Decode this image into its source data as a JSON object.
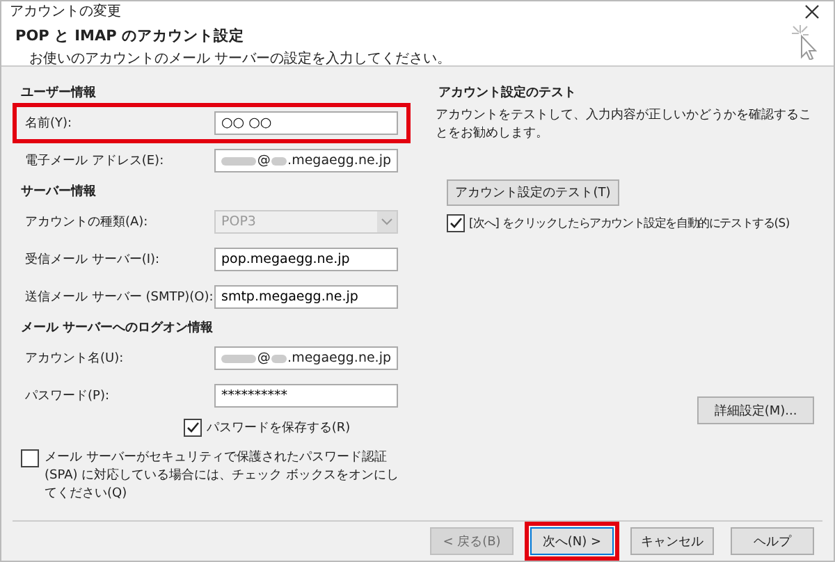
{
  "window": {
    "title": "アカウントの変更"
  },
  "header": {
    "title": "POP と IMAP のアカウント設定",
    "subtitle": "お使いのアカウントのメール サーバーの設定を入力してください。"
  },
  "left": [
    {
      "kind": "heading",
      "text": "ユーザー情報"
    },
    {
      "kind": "field",
      "label": "名前(Y):",
      "value": "○○ ○○",
      "highlighted": true
    },
    {
      "kind": "redacted",
      "label": "電子メール アドレス(E):",
      "parts": [
        "@",
        ".megaegg.ne.jp"
      ]
    },
    {
      "kind": "heading",
      "text": "サーバー情報"
    },
    {
      "kind": "select",
      "label": "アカウントの種類(A):",
      "value": "POP3",
      "disabled": true
    },
    {
      "kind": "field",
      "label": "受信メール サーバー(I):",
      "value": "pop.megaegg.ne.jp",
      "highlighted": false
    },
    {
      "kind": "field",
      "label": "送信メール サーバー (SMTP)(O):",
      "value": "smtp.megaegg.ne.jp",
      "highlighted": false
    },
    {
      "kind": "heading",
      "text": "メール サーバーへのログオン情報"
    },
    {
      "kind": "redacted",
      "label": "アカウント名(U):",
      "parts": [
        "@",
        ".megaegg.ne.jp"
      ]
    },
    {
      "kind": "field",
      "label": "パスワード(P):",
      "value": "**********",
      "highlighted": false
    },
    {
      "kind": "checkbox",
      "label": "パスワードを保存する(R)",
      "checked": true
    }
  ],
  "spa": {
    "label": "メール サーバーがセキュリティで保護されたパスワード認証 (SPA) に対応している場合には、チェック ボックスをオンにしてください(Q)",
    "checked": false
  },
  "test": {
    "title": "アカウント設定のテスト",
    "description": "アカウントをテストして、入力内容が正しいかどうかを確認することをお勧めします。",
    "button": "アカウント設定のテスト(T)",
    "auto": {
      "label": "[次へ] をクリックしたらアカウント設定を自動的にテストする(S)",
      "checked": true
    }
  },
  "more_button": "詳細設定(M)...",
  "buttons": [
    {
      "label": "< 戻る(B)",
      "disabled": true,
      "highlighted": false
    },
    {
      "label": "次へ(N) >",
      "disabled": false,
      "highlighted": true
    },
    {
      "label": "キャンセル",
      "disabled": false,
      "highlighted": false
    },
    {
      "label": "ヘルプ",
      "disabled": false,
      "highlighted": false
    }
  ]
}
